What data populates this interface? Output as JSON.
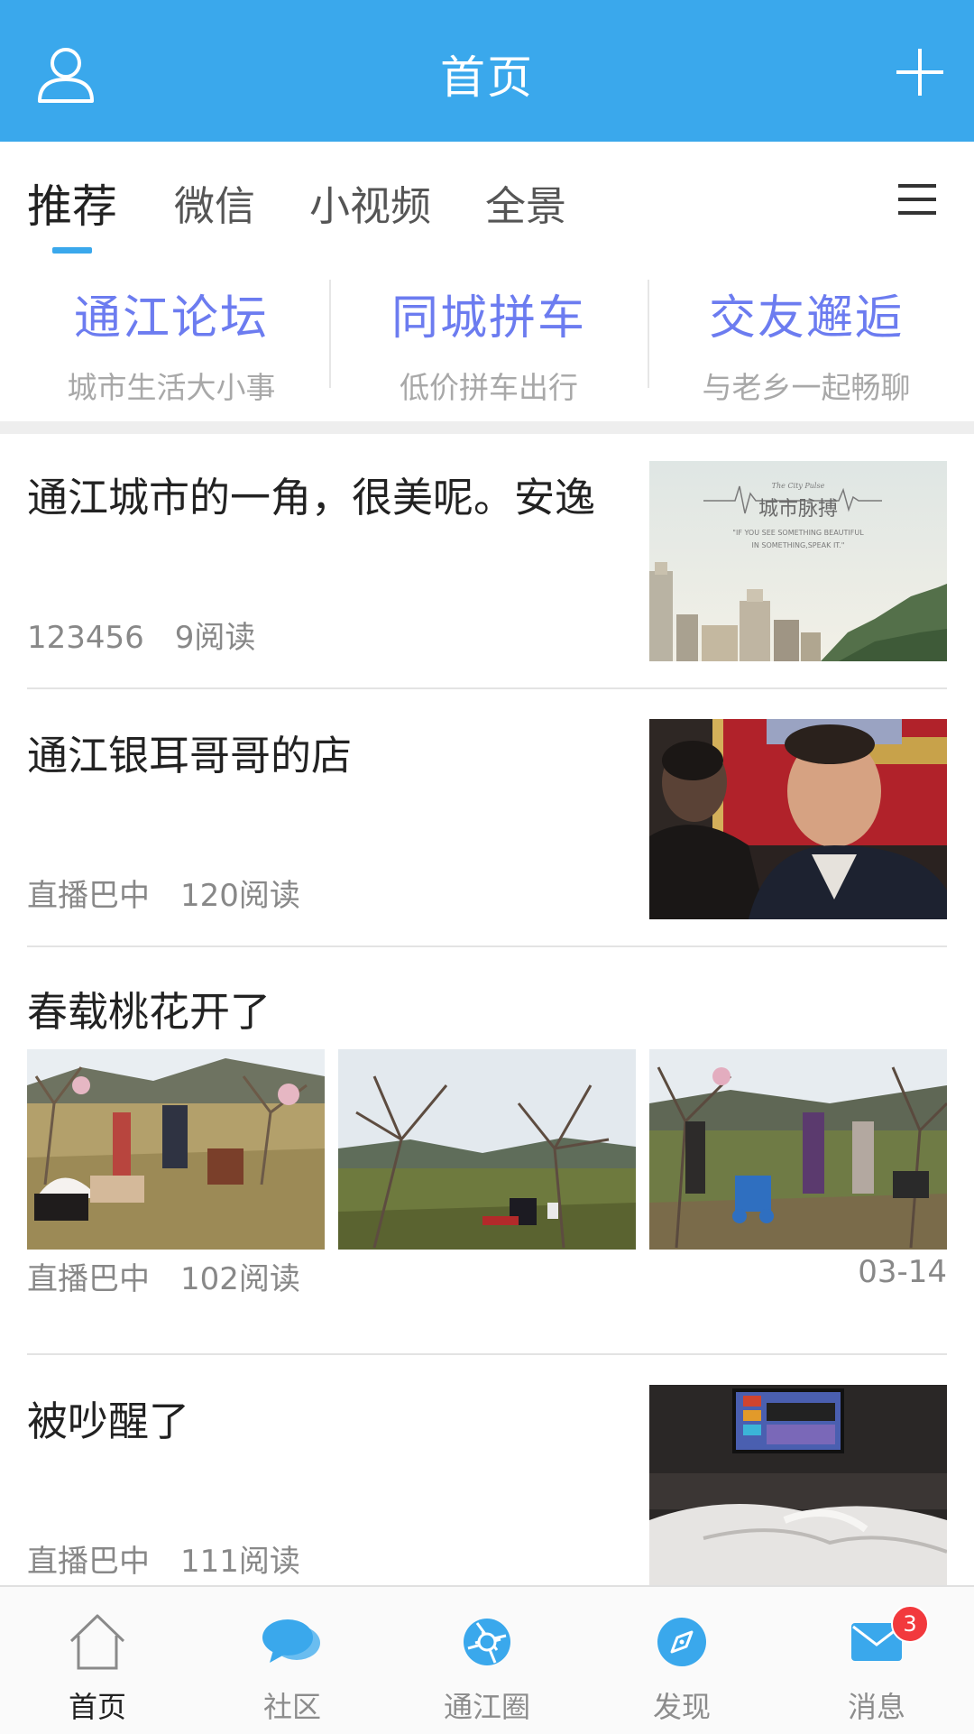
{
  "header": {
    "title": "首页",
    "icons": {
      "left": "user-icon",
      "right": "plus-icon"
    }
  },
  "tabs": [
    {
      "label": "推荐",
      "active": true
    },
    {
      "label": "微信"
    },
    {
      "label": "小视频"
    },
    {
      "label": "全景"
    }
  ],
  "quick_links": [
    {
      "title": "通江论坛",
      "subtitle": "城市生活大小事"
    },
    {
      "title": "同城拼车",
      "subtitle": "低价拼车出行"
    },
    {
      "title": "交友邂逅",
      "subtitle": "与老乡一起畅聊"
    }
  ],
  "articles": [
    {
      "title": "通江城市的一角，很美呢。安逸",
      "source": "123456",
      "reads": "9阅读",
      "image_text": {
        "brand": "The City Pulse",
        "title": "城市脉搏",
        "line1": "\"IF YOU SEE SOMETHING BEAUTIFUL",
        "line2": "IN SOMETHING,SPEAK IT.\""
      }
    },
    {
      "title": "通江银耳哥哥的店",
      "source": "直播巴中",
      "reads": "120阅读"
    },
    {
      "title": "春载桃花开了",
      "source": "直播巴中",
      "reads": "102阅读",
      "date": "03-14"
    },
    {
      "title": "被吵醒了",
      "source": "直播巴中",
      "reads": "111阅读"
    }
  ],
  "bottom_nav": [
    {
      "label": "首页",
      "icon": "home-icon",
      "active": true
    },
    {
      "label": "社区",
      "icon": "chat-bubbles-icon"
    },
    {
      "label": "通江圈",
      "icon": "aperture-icon"
    },
    {
      "label": "发现",
      "icon": "compass-icon"
    },
    {
      "label": "消息",
      "icon": "mail-icon",
      "badge": "3"
    }
  ],
  "colors": {
    "primary": "#3aa8ec",
    "quick_link": "#6c7cf0",
    "badge": "#f2393d"
  }
}
